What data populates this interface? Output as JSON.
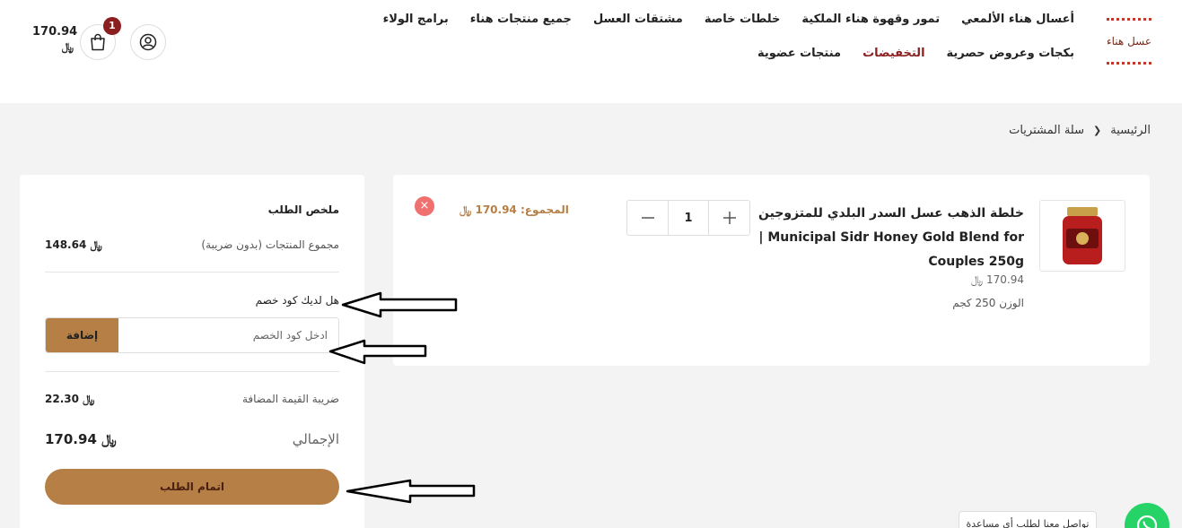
{
  "header": {
    "logo_text": "عسل هناء",
    "nav": [
      {
        "label": "أعسال هناء الألمعي",
        "sale": false
      },
      {
        "label": "تمور وقهوة هناء الملكية",
        "sale": false
      },
      {
        "label": "خلطات خاصة",
        "sale": false
      },
      {
        "label": "مشتقات العسل",
        "sale": false
      },
      {
        "label": "جميع منتجات هناء",
        "sale": false
      },
      {
        "label": "برامج الولاء",
        "sale": false
      },
      {
        "label": "بكجات وعروض حصرية",
        "sale": false
      },
      {
        "label": "التخفيضات",
        "sale": true
      },
      {
        "label": "منتجات عضوية",
        "sale": false
      }
    ],
    "cart_count": "1",
    "cart_total": "170.94",
    "currency": "﷼"
  },
  "breadcrumb": {
    "home": "الرئيسية",
    "current": "سلة المشتريات"
  },
  "cart_item": {
    "title_line1": "خلطة الذهب عسل السدر البلدي للمتزوجين",
    "title_line2": "Municipal Sidr Honey Gold Blend for |",
    "title_line3": "Couples 250g",
    "price": "170.94 ﷼",
    "weight": "الوزن 250 كجم",
    "quantity": "1",
    "total_label": "المجموع: 170.94 ﷼",
    "remove_symbol": "×"
  },
  "summary": {
    "title": "ملخص الطلب",
    "subtotal_label": "مجموع المنتجات (بدون ضريبة)",
    "subtotal_value": "148.64 ﷼",
    "coupon_question": "هل لديك كود خصم",
    "coupon_placeholder": "ادخل كود الخصم",
    "coupon_value": "",
    "apply_label": "إضافة",
    "vat_label": "ضريبة القيمة المضافة",
    "vat_value": "22.30 ﷼",
    "grand_label": "الإجمالي",
    "grand_value": "170.94 ﷼",
    "checkout_label": "اتمام الطلب"
  },
  "whatsapp": {
    "tooltip": "تواصل معنا لطلب أي مساعدة"
  },
  "colors": {
    "accent": "#b57f45",
    "brand_dark": "#8b1e1e",
    "remove": "#f07070",
    "whatsapp": "#25d366"
  }
}
